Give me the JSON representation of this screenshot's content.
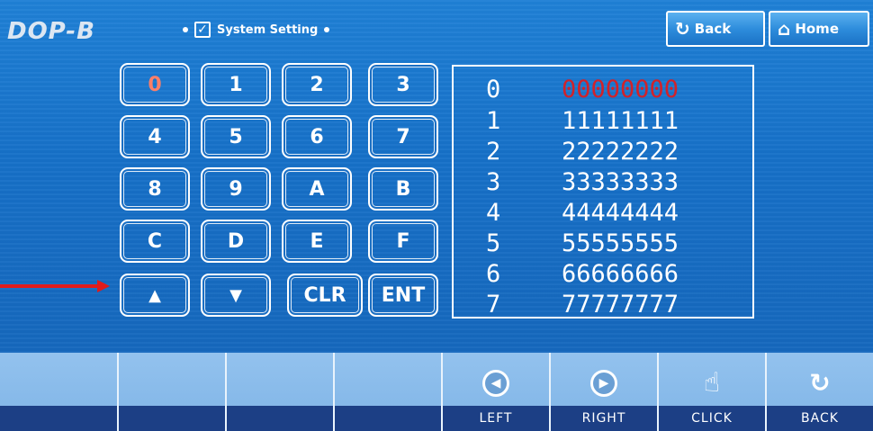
{
  "header": {
    "logo": "DOP-B",
    "breadcrumb": "System Setting",
    "checkbox_mark": "✓",
    "back_label": "Back",
    "home_label": "Home"
  },
  "keypad": {
    "keys": [
      "0",
      "1",
      "2",
      "3",
      "4",
      "5",
      "6",
      "7",
      "8",
      "9",
      "A",
      "B",
      "C",
      "D",
      "E",
      "F",
      "▲",
      "▼",
      "CLR",
      "ENT"
    ]
  },
  "display": {
    "rows": [
      {
        "index": "0",
        "value": "00000000"
      },
      {
        "index": "1",
        "value": "11111111"
      },
      {
        "index": "2",
        "value": "22222222"
      },
      {
        "index": "3",
        "value": "33333333"
      },
      {
        "index": "4",
        "value": "44444444"
      },
      {
        "index": "5",
        "value": "55555555"
      },
      {
        "index": "6",
        "value": "66666666"
      },
      {
        "index": "7",
        "value": "77777777"
      }
    ]
  },
  "function_bar": {
    "keys": [
      "",
      "",
      "",
      "",
      "LEFT",
      "RIGHT",
      "CLICK",
      "BACK"
    ]
  },
  "colors": {
    "screen_blue": "#1670c8",
    "strip_navy": "#1c3f85",
    "highlight_red": "#d1222a",
    "annotation_arrow": "#e01b1b"
  }
}
